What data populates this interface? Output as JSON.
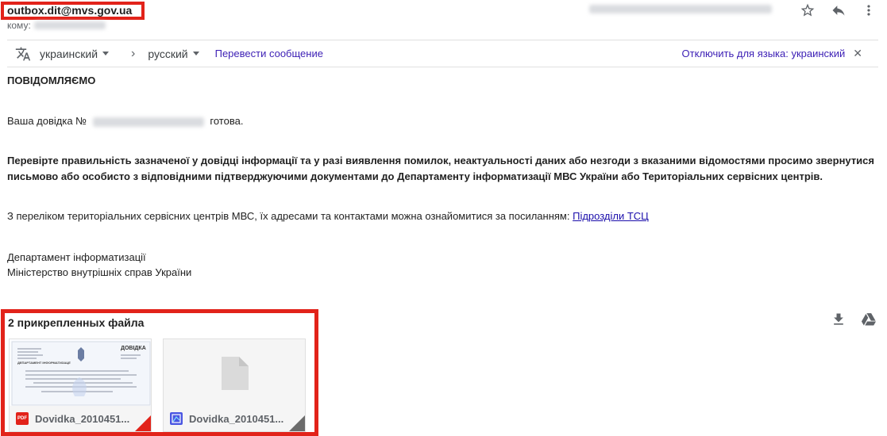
{
  "header": {
    "sender": "outbox.dit@mvs.gov.ua",
    "to_label": "кому:"
  },
  "translation": {
    "source_lang": "украинский",
    "target_lang": "русский",
    "translate_link": "Перевести сообщение",
    "disable_link": "Отключить для языка: украинский"
  },
  "message": {
    "heading": "ПОВІДОМЛЯЄМО",
    "ready_prefix": "Ваша довідка №",
    "ready_suffix": "готова.",
    "notice_line1": "Перевірте правильність зазначеної у довідці інформації та у разі виявлення помилок, неактуальності даних або незгоди з вказаними відомостями просимо звернутися",
    "notice_line2": "письмово або особисто з відповідними підтверджуючими документами до Департаменту інформатизації МВС України або Територіальних сервісних центрів.",
    "list_text": "З переліком територіальних сервісних центрів МВС, їх адресами та контактами можна ознайомитися за посиланням:",
    "list_link": "Підрозділи ТСЦ",
    "signature_line1": "Департамент інформатизації",
    "signature_line2": "Міністерство внутрішніх справ України"
  },
  "attachments": {
    "title": "2 прикрепленных файла",
    "files": [
      {
        "name": "Dovidka_2010451...",
        "type": "pdf",
        "badge": "PDF",
        "accent": "#e2231a"
      },
      {
        "name": "Dovidka_2010451...",
        "type": "image",
        "accent": "#4a56e2"
      }
    ],
    "preview": {
      "doc_title": "ДОВІДКА",
      "doc_subtitle": "ДЕПАРТАМЕНТ ІНФОРМАТИЗАЦІЇ"
    }
  },
  "icons": [
    "star-icon",
    "reply-icon",
    "more-vert-icon",
    "translate-icon",
    "chevron-right-icon",
    "close-icon",
    "download-icon",
    "drive-icon",
    "generic-file-icon"
  ],
  "colors": {
    "highlight": "#e2231a",
    "link": "#1a0dab",
    "translate_link": "#3c1fb5",
    "muted": "#5f6368"
  }
}
